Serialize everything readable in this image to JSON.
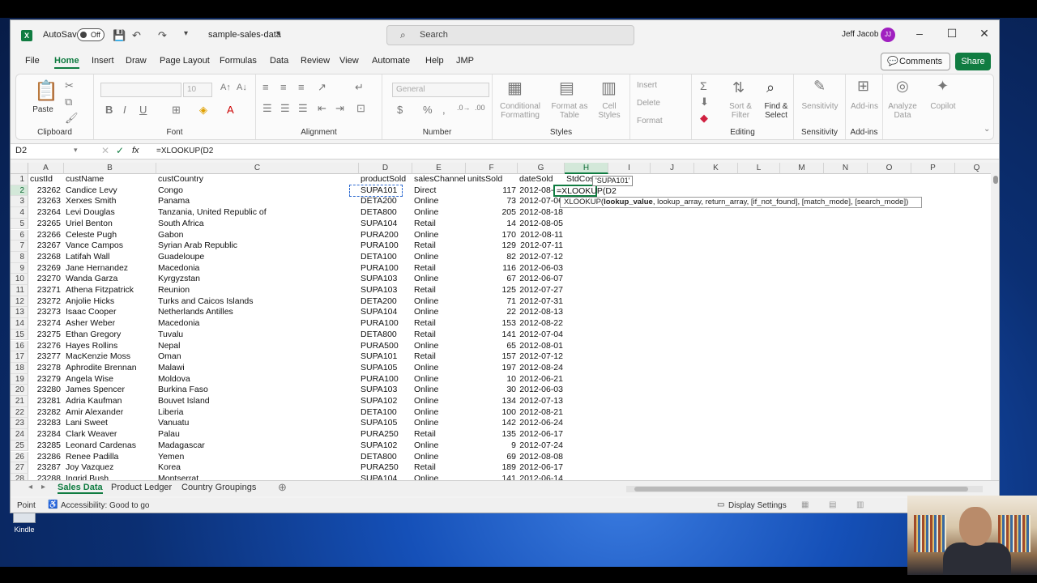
{
  "titlebar": {
    "autosave_label": "AutoSave",
    "toggle_state": "Off",
    "filename": "sample-sales-data",
    "search_placeholder": "Search",
    "user_name": "Jeff Jacob",
    "user_initials": "JJ"
  },
  "menu": {
    "items": [
      "File",
      "Home",
      "Insert",
      "Draw",
      "Page Layout",
      "Formulas",
      "Data",
      "Review",
      "View",
      "Automate",
      "Help",
      "JMP"
    ],
    "active": "Home",
    "comments_label": "Comments",
    "share_label": "Share"
  },
  "ribbon": {
    "clipboard": {
      "label": "Clipboard",
      "paste": "Paste"
    },
    "font": {
      "label": "Font",
      "size": "10"
    },
    "alignment": {
      "label": "Alignment"
    },
    "number": {
      "label": "Number",
      "format": "General"
    },
    "styles": {
      "label": "Styles",
      "conditional": "Conditional Formatting",
      "format_table": "Format as Table",
      "cell_styles": "Cell Styles"
    },
    "cells": {
      "insert": "Insert",
      "delete": "Delete",
      "format": "Format"
    },
    "editing": {
      "label": "Editing",
      "sort": "Sort & Filter",
      "find": "Find & Select"
    },
    "sensitivity": {
      "label": "Sensitivity",
      "button": "Sensitivity"
    },
    "addins": {
      "label": "Add-ins",
      "button": "Add-ins",
      "analyze": "Analyze Data",
      "copilot": "Copilot"
    }
  },
  "formula_bar": {
    "name_box": "D2",
    "fx": "fx",
    "formula": "=XLOOKUP(D2"
  },
  "columns": [
    "A",
    "B",
    "C",
    "D",
    "E",
    "F",
    "G",
    "H",
    "I",
    "J",
    "K",
    "L",
    "M",
    "N",
    "O",
    "P",
    "Q"
  ],
  "selected_column": "H",
  "header_row": [
    "custId",
    "custName",
    "custCountry",
    "productSold",
    "salesChannel",
    "unitsSold",
    "dateSold",
    "StdCost"
  ],
  "rows": [
    [
      "23262",
      "Candice Levy",
      "Congo",
      "SUPA101",
      "Direct",
      "117",
      "2012-08-09"
    ],
    [
      "23263",
      "Xerxes Smith",
      "Panama",
      "DETA200",
      "Online",
      "73",
      "2012-07-06"
    ],
    [
      "23264",
      "Levi Douglas",
      "Tanzania, United Republic of",
      "DETA800",
      "Online",
      "205",
      "2012-08-18"
    ],
    [
      "23265",
      "Uriel Benton",
      "South Africa",
      "SUPA104",
      "Retail",
      "14",
      "2012-08-05"
    ],
    [
      "23266",
      "Celeste Pugh",
      "Gabon",
      "PURA200",
      "Online",
      "170",
      "2012-08-11"
    ],
    [
      "23267",
      "Vance Campos",
      "Syrian Arab Republic",
      "PURA100",
      "Retail",
      "129",
      "2012-07-11"
    ],
    [
      "23268",
      "Latifah Wall",
      "Guadeloupe",
      "DETA100",
      "Online",
      "82",
      "2012-07-12"
    ],
    [
      "23269",
      "Jane Hernandez",
      "Macedonia",
      "PURA100",
      "Retail",
      "116",
      "2012-06-03"
    ],
    [
      "23270",
      "Wanda Garza",
      "Kyrgyzstan",
      "SUPA103",
      "Online",
      "67",
      "2012-06-07"
    ],
    [
      "23271",
      "Athena Fitzpatrick",
      "Reunion",
      "SUPA103",
      "Retail",
      "125",
      "2012-07-27"
    ],
    [
      "23272",
      "Anjolie Hicks",
      "Turks and Caicos Islands",
      "DETA200",
      "Online",
      "71",
      "2012-07-31"
    ],
    [
      "23273",
      "Isaac Cooper",
      "Netherlands Antilles",
      "SUPA104",
      "Online",
      "22",
      "2012-08-13"
    ],
    [
      "23274",
      "Asher Weber",
      "Macedonia",
      "PURA100",
      "Retail",
      "153",
      "2012-08-22"
    ],
    [
      "23275",
      "Ethan Gregory",
      "Tuvalu",
      "DETA800",
      "Retail",
      "141",
      "2012-07-04"
    ],
    [
      "23276",
      "Hayes Rollins",
      "Nepal",
      "PURA500",
      "Online",
      "65",
      "2012-08-01"
    ],
    [
      "23277",
      "MacKenzie Moss",
      "Oman",
      "SUPA101",
      "Retail",
      "157",
      "2012-07-12"
    ],
    [
      "23278",
      "Aphrodite Brennan",
      "Malawi",
      "SUPA105",
      "Online",
      "197",
      "2012-08-24"
    ],
    [
      "23279",
      "Angela Wise",
      "Moldova",
      "PURA100",
      "Online",
      "10",
      "2012-06-21"
    ],
    [
      "23280",
      "James Spencer",
      "Burkina Faso",
      "SUPA103",
      "Online",
      "30",
      "2012-06-03"
    ],
    [
      "23281",
      "Adria Kaufman",
      "Bouvet Island",
      "SUPA102",
      "Online",
      "134",
      "2012-07-13"
    ],
    [
      "23282",
      "Amir Alexander",
      "Liberia",
      "DETA100",
      "Online",
      "100",
      "2012-08-21"
    ],
    [
      "23283",
      "Lani Sweet",
      "Vanuatu",
      "SUPA105",
      "Online",
      "142",
      "2012-06-24"
    ],
    [
      "23284",
      "Clark Weaver",
      "Palau",
      "PURA250",
      "Retail",
      "135",
      "2012-06-17"
    ],
    [
      "23285",
      "Leonard Cardenas",
      "Madagascar",
      "SUPA102",
      "Online",
      "9",
      "2012-07-24"
    ],
    [
      "23286",
      "Renee Padilla",
      "Yemen",
      "DETA800",
      "Online",
      "69",
      "2012-08-08"
    ],
    [
      "23287",
      "Joy Vazquez",
      "Korea",
      "PURA250",
      "Retail",
      "189",
      "2012-06-17"
    ],
    [
      "23288",
      "Ingrid Bush",
      "Montserrat",
      "SUPA104",
      "Online",
      "141",
      "2012-06-14"
    ]
  ],
  "active_cell_text": "=XLOOKUP(D2",
  "hover_tip": "'SUPA101'",
  "tooltip": {
    "fn": "XLOOKUP(",
    "bold_arg": "lookup_value",
    "rest": ", lookup_array, return_array, [if_not_found], [match_mode], [search_mode])"
  },
  "sheets": [
    "Sales Data",
    "Product Ledger",
    "Country Groupings"
  ],
  "active_sheet": "Sales Data",
  "status": {
    "mode": "Point",
    "accessibility": "Accessibility: Good to go",
    "display_settings": "Display Settings"
  },
  "desktop_icon_label": "Kindle",
  "colors": {
    "excel_green": "#107c41",
    "selection_blue": "#2e6bd1"
  }
}
